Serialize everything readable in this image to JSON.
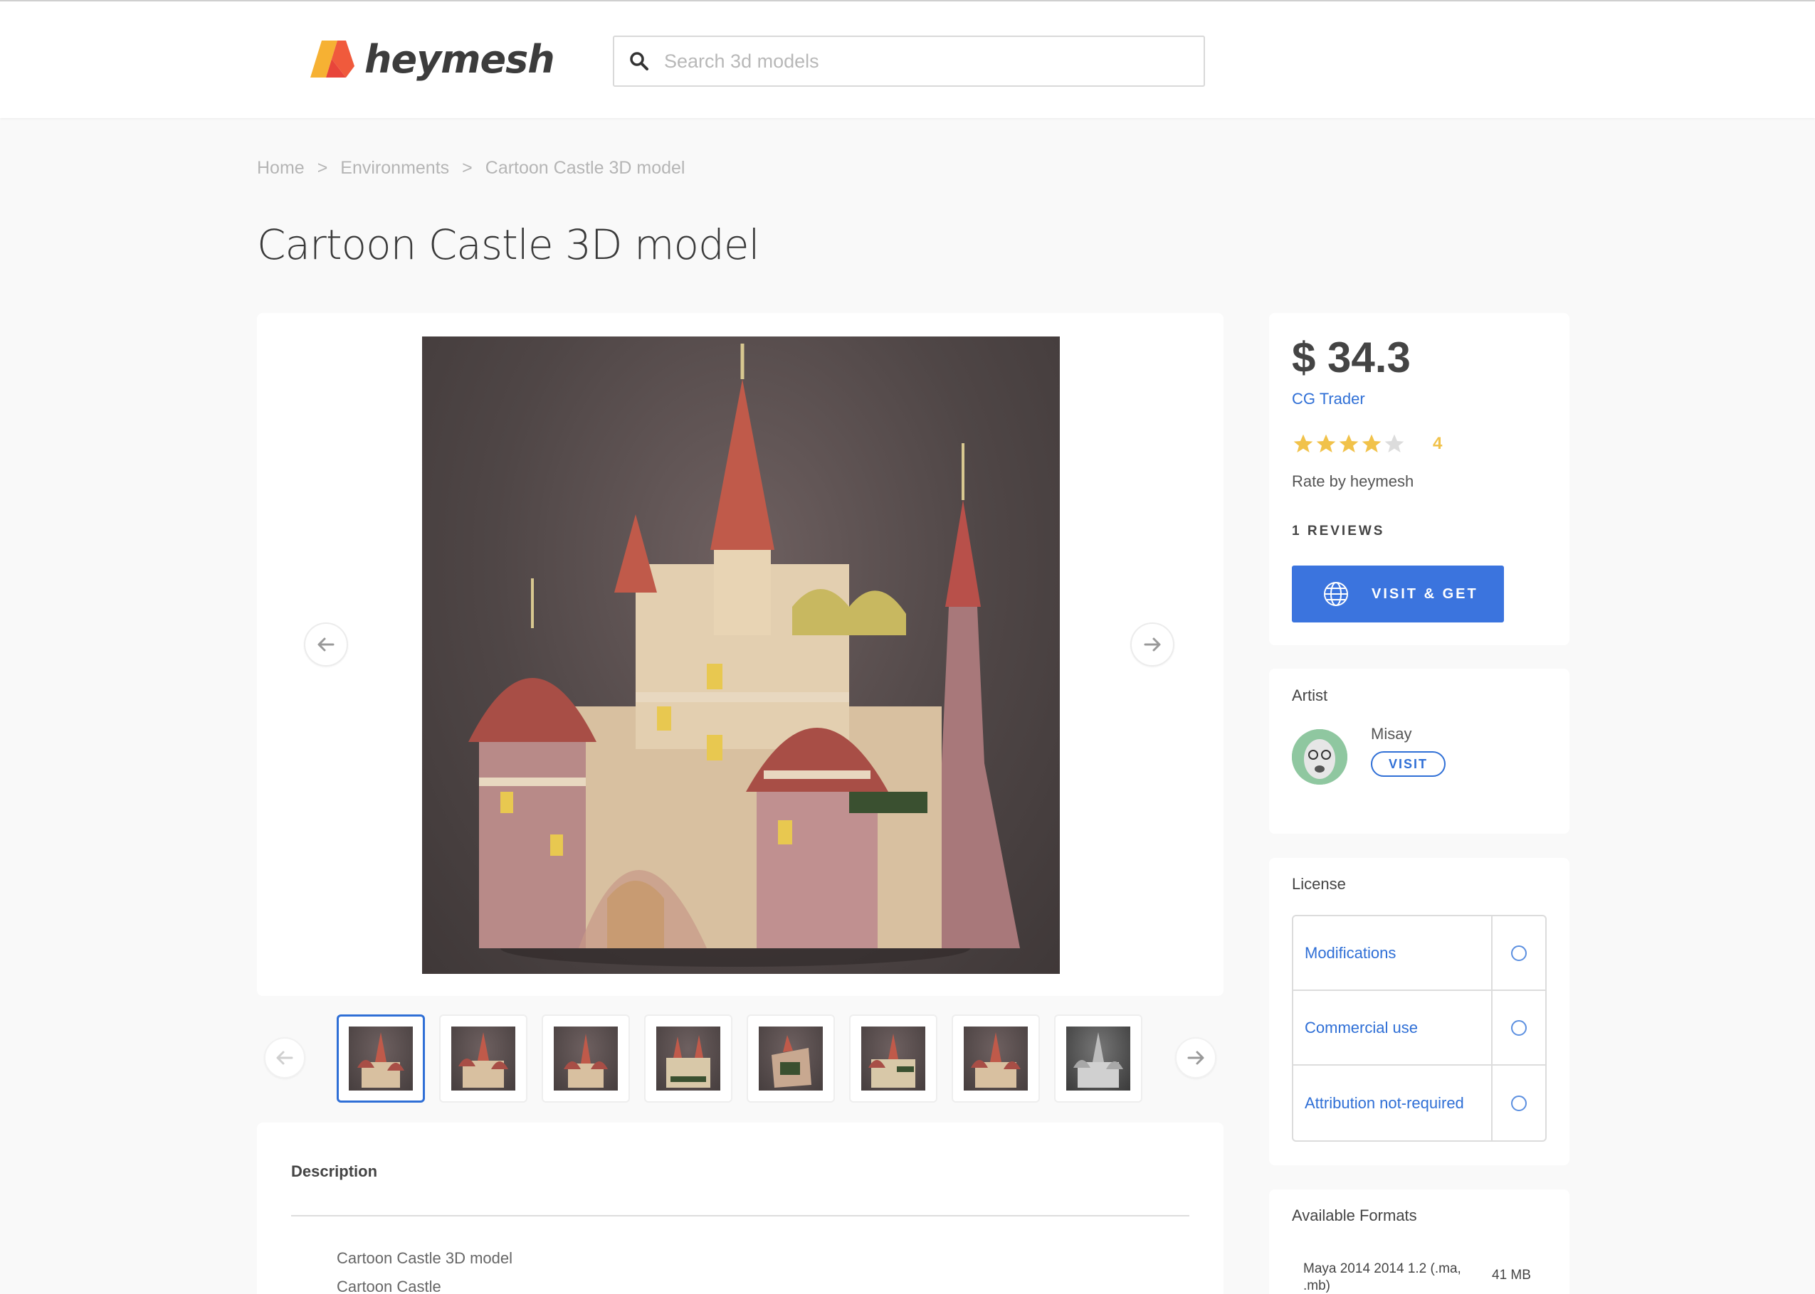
{
  "header": {
    "logo_text": "heymesh",
    "search_placeholder": "Search 3d models",
    "search_value": ""
  },
  "breadcrumb": {
    "items": [
      "Home",
      "Environments",
      "Cartoon Castle 3D model"
    ],
    "separator": ">"
  },
  "page_title": "Cartoon Castle 3D model",
  "gallery": {
    "thumbnail_count": 8,
    "active_index": 0
  },
  "description": {
    "title": "Description",
    "lines": [
      "Cartoon Castle 3D model",
      "Cartoon Castle"
    ]
  },
  "purchase": {
    "price": "$ 34.3",
    "vendor": "CG Trader",
    "rating": {
      "value": "4",
      "stars_filled": 4,
      "stars_total": 5
    },
    "rate_by": "Rate by heymesh",
    "reviews": "1 REVIEWS",
    "visit_get_label": "VISIT & GET"
  },
  "artist": {
    "label": "Artist",
    "name": "Misay",
    "visit_label": "VISIT"
  },
  "license": {
    "label": "License",
    "items": [
      "Modifications",
      "Commercial use",
      "Attribution not-required"
    ]
  },
  "formats": {
    "label": "Available Formats",
    "items": [
      {
        "name": "Maya 2014 2014 1.2 (.ma, .mb)",
        "size": "41 MB"
      }
    ]
  },
  "colors": {
    "accent": "#3b74de",
    "link": "#2f6fd6",
    "star": "#f1c24a",
    "background": "#f9f9f9"
  },
  "icons": [
    "heymesh-logo-icon",
    "search-icon",
    "arrow-left-icon",
    "arrow-right-icon",
    "star-icon",
    "globe-icon"
  ]
}
